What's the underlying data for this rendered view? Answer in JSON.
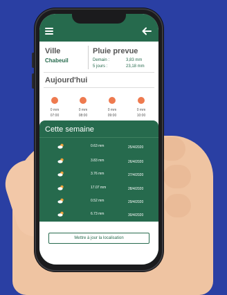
{
  "header": {
    "menu_icon": "hamburger-menu-icon",
    "back_icon": "arrow-left-icon"
  },
  "location": {
    "label": "Ville",
    "city": "Chabeuil"
  },
  "forecast": {
    "title": "Pluie prevue",
    "rows": [
      {
        "label": "Demain :",
        "value": "3,83 mm"
      },
      {
        "label": "5 jours :",
        "value": "23,18 mm"
      }
    ]
  },
  "today": {
    "title": "Aujourd'hui",
    "hours": [
      {
        "amount": "0 mm",
        "time": "07:00"
      },
      {
        "amount": "0 mm",
        "time": "08:00"
      },
      {
        "amount": "0 mm",
        "time": "09:00"
      },
      {
        "amount": "0 mm",
        "time": "10:00"
      }
    ]
  },
  "week": {
    "title": "Cette semaine",
    "days": [
      {
        "icon": "cloud-sun-icon",
        "amount": "0.63 mm",
        "date": "25/4/2020"
      },
      {
        "icon": "cloud-sun-icon",
        "amount": "3.83 mm",
        "date": "26/4/2020"
      },
      {
        "icon": "cloud-sun-icon",
        "amount": "3.76 mm",
        "date": "27/4/2020"
      },
      {
        "icon": "cloud-sun-icon",
        "amount": "17.07 mm",
        "date": "28/4/2020"
      },
      {
        "icon": "cloud-sun-icon",
        "amount": "0.52 mm",
        "date": "29/4/2020"
      },
      {
        "icon": "cloud-sun-icon",
        "amount": "6.73 mm",
        "date": "30/4/2020"
      }
    ]
  },
  "footer": {
    "update_location_label": "Mettre à jour la localisation"
  },
  "colors": {
    "primary": "#266a4d",
    "sun": "#ee7a4f",
    "background": "#2a3fa3"
  }
}
